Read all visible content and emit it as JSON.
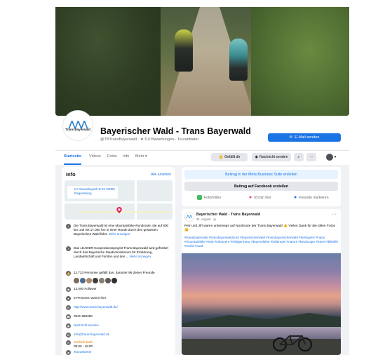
{
  "page": {
    "title": "Bayerischer Wald - Trans Bayerwald",
    "logo_text": "Trans Bayerwald",
    "subtitle": "@TBTransBayerwald · ★ 5.0 Bewertungen · Touranbieter",
    "mail_button": "E-Mail senden"
  },
  "tabs": [
    {
      "label": "Startseite",
      "active": true
    },
    {
      "label": "Videos"
    },
    {
      "label": "Fotos"
    },
    {
      "label": "Info"
    },
    {
      "label": "Mehr ▾"
    }
  ],
  "actions": {
    "like": "Gefällt dir",
    "message": "Nachricht senden",
    "search_icon": "search-icon",
    "more_icon": "ellipsis-icon"
  },
  "info": {
    "title": "Info",
    "see_all": "Alle ansehen",
    "address": "Im Gewerbepark D 04 93059 Regensburg",
    "description": "Die Trans Bayerwald ist eine Mountainbike-Rundroute, die auf 800 km und mit 17.000 hm in einer Runde durch den gesamten Bayerischen Wald führt.",
    "description_more": "Mehr anzeigen",
    "leader": "Das LEADER-Kooperationsprojekt Trans Bayerwald wird gefördert durch das Bayerische Staatsministerium für Ernährung, Landwirtschaft und Forsten und den ...",
    "leader_more": "Mehr anzeigen",
    "likes": "12.723 Personen gefällt das, darunter 96 deiner Freunde",
    "followers": "13.000 Follower",
    "checkins": "8 Personen waren hier",
    "website": "http://www.trans-bayerwald.de/",
    "phone": "0941 585390",
    "send_message": "Nachricht senden",
    "email": "info@trans-bayerwald.de",
    "hours_status": "Schließt bald",
    "hours": "08:00 - 16:00 ·",
    "category": "Touranbieter"
  },
  "business": {
    "meta_suite": "Beitrag in der Meta Business Suite erstellen",
    "create_post": "Beitrag auf Facebook erstellen",
    "photo_video": "Foto/Video",
    "checkin": "Ich bin hier",
    "tag_friends": "Freunde markieren"
  },
  "post": {
    "author": "Bayerischer Wald - Trans Bayerwald",
    "date": "31. August · ◎",
    "text": "Petr und Jiří waren unterwegs auf Nordroute der Trans Bayerwald 👍 Vielen Dank für die tollen Fotos 😊",
    "tags": "#transbayerwald #transbayerwaldnord #bayerischerwald #meinbayerischerwald #derbayern #natur #mountainbike #mtb #mtbayern #visitgermany #bayernliebe #mtbtravel #nature #landscape #travel #bikelife #world #outd"
  },
  "colors": {
    "accent": "#1b74e4",
    "background": "#f0f2f5",
    "text_secondary": "#65676b"
  }
}
